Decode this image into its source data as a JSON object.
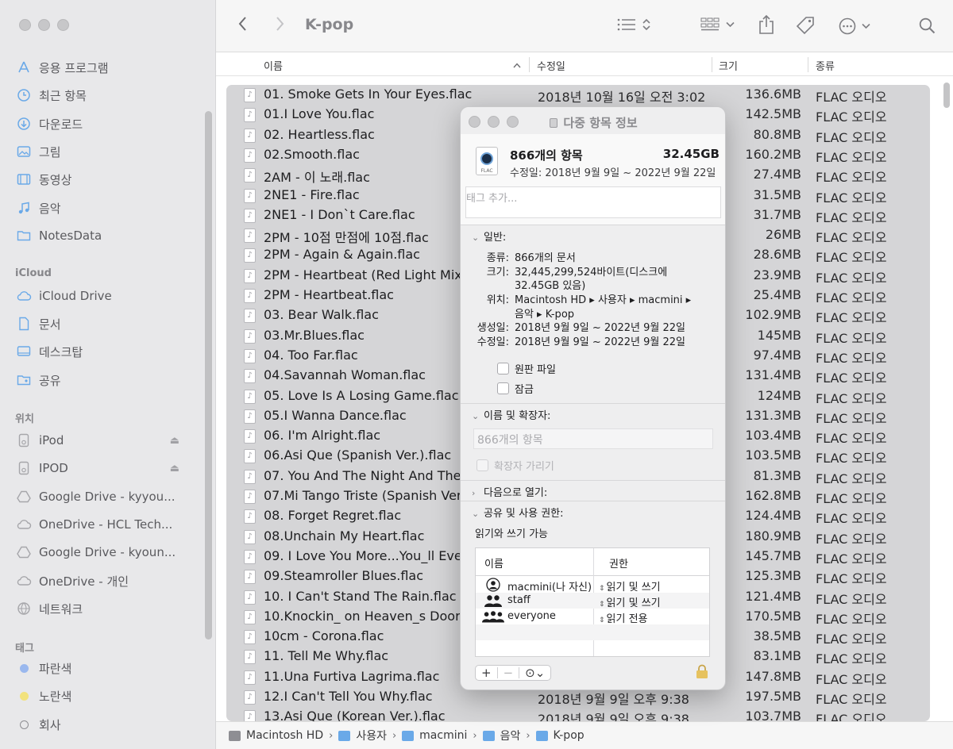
{
  "window": {
    "title": "K-pop"
  },
  "sidebar": {
    "favorites": [
      {
        "label": "응용 프로그램",
        "icon": "applications-icon"
      },
      {
        "label": "최근 항목",
        "icon": "clock-icon"
      },
      {
        "label": "다운로드",
        "icon": "download-icon"
      },
      {
        "label": "그림",
        "icon": "photo-icon"
      },
      {
        "label": "동영상",
        "icon": "film-icon"
      },
      {
        "label": "음악",
        "icon": "music-note-icon"
      },
      {
        "label": "NotesData",
        "icon": "folder-icon"
      }
    ],
    "icloud_header": "iCloud",
    "icloud": [
      {
        "label": "iCloud Drive",
        "icon": "cloud-icon"
      },
      {
        "label": "문서",
        "icon": "document-icon"
      },
      {
        "label": "데스크탑",
        "icon": "desktop-icon"
      },
      {
        "label": "공유",
        "icon": "shared-folder-icon"
      }
    ],
    "locations_header": "위치",
    "locations": [
      {
        "label": "iPod",
        "icon": "ipod-icon",
        "eject": "⏏"
      },
      {
        "label": "IPOD",
        "icon": "ipod-icon",
        "eject": "⏏"
      },
      {
        "label": "Google Drive - kyyou...",
        "icon": "google-drive-icon"
      },
      {
        "label": "OneDrive - HCL Tech...",
        "icon": "cloud-icon"
      },
      {
        "label": "Google Drive - kyoun...",
        "icon": "google-drive-icon"
      },
      {
        "label": "OneDrive - 개인",
        "icon": "cloud-icon"
      },
      {
        "label": "네트워크",
        "icon": "network-icon"
      }
    ],
    "tags_header": "태그",
    "tags": [
      {
        "label": "파란색",
        "color": "#9ab8ee"
      },
      {
        "label": "노란색",
        "color": "#f2e27d"
      },
      {
        "label": "회사",
        "color": ""
      }
    ]
  },
  "columns": {
    "name": "이름",
    "modified": "수정일",
    "size": "크기",
    "kind": "종류"
  },
  "files": [
    {
      "name": "01. Smoke Gets In Your Eyes.flac",
      "modified": "2018년 10월 16일 오전 3:02",
      "size": "136.6MB",
      "kind": "FLAC 오디오"
    },
    {
      "name": "01.I Love You.flac",
      "modified": "",
      "size": "142.5MB",
      "kind": "FLAC 오디오"
    },
    {
      "name": "02. Heartless.flac",
      "modified": "",
      "size": "80.8MB",
      "kind": "FLAC 오디오"
    },
    {
      "name": "02.Smooth.flac",
      "modified": "",
      "size": "160.2MB",
      "kind": "FLAC 오디오"
    },
    {
      "name": "2AM - 이 노래.flac",
      "modified": "",
      "size": "27.4MB",
      "kind": "FLAC 오디오"
    },
    {
      "name": "2NE1 - Fire.flac",
      "modified": "",
      "size": "31.5MB",
      "kind": "FLAC 오디오"
    },
    {
      "name": "2NE1 - I Don`t Care.flac",
      "modified": "",
      "size": "31.7MB",
      "kind": "FLAC 오디오"
    },
    {
      "name": "2PM - 10점 만점에 10점.flac",
      "modified": "",
      "size": "26MB",
      "kind": "FLAC 오디오"
    },
    {
      "name": "2PM - Again & Again.flac",
      "modified": "",
      "size": "28.6MB",
      "kind": "FLAC 오디오"
    },
    {
      "name": "2PM - Heartbeat (Red Light Mix",
      "modified": "",
      "size": "23.9MB",
      "kind": "FLAC 오디오"
    },
    {
      "name": "2PM - Heartbeat.flac",
      "modified": "",
      "size": "25.4MB",
      "kind": "FLAC 오디오"
    },
    {
      "name": "03. Bear Walk.flac",
      "modified": "",
      "size": "102.9MB",
      "kind": "FLAC 오디오"
    },
    {
      "name": "03.Mr.Blues.flac",
      "modified": "",
      "size": "145MB",
      "kind": "FLAC 오디오"
    },
    {
      "name": "04. Too Far.flac",
      "modified": "",
      "size": "97.4MB",
      "kind": "FLAC 오디오"
    },
    {
      "name": "04.Savannah Woman.flac",
      "modified": "",
      "size": "131.4MB",
      "kind": "FLAC 오디오"
    },
    {
      "name": "05. Love Is A Losing Game.flac",
      "modified": "",
      "size": "124MB",
      "kind": "FLAC 오디오"
    },
    {
      "name": "05.I Wanna Dance.flac",
      "modified": "",
      "size": "131.3MB",
      "kind": "FLAC 오디오"
    },
    {
      "name": "06. I'm Alright.flac",
      "modified": "",
      "size": "103.4MB",
      "kind": "FLAC 오디오"
    },
    {
      "name": "06.Asi Que (Spanish Ver.).flac",
      "modified": "",
      "size": "103.5MB",
      "kind": "FLAC 오디오"
    },
    {
      "name": "07. You And The Night And The M",
      "modified": "",
      "size": "81.3MB",
      "kind": "FLAC 오디오"
    },
    {
      "name": "07.Mi Tango Triste (Spanish Ver.)",
      "modified": "",
      "size": "162.8MB",
      "kind": "FLAC 오디오"
    },
    {
      "name": "08. Forget Regret.flac",
      "modified": "",
      "size": "124.4MB",
      "kind": "FLAC 오디오"
    },
    {
      "name": "08.Unchain My Heart.flac",
      "modified": "",
      "size": "180.9MB",
      "kind": "FLAC 오디오"
    },
    {
      "name": "09. I Love You More...You_ll Ever",
      "modified": "",
      "size": "145.7MB",
      "kind": "FLAC 오디오"
    },
    {
      "name": "09.Steamroller Blues.flac",
      "modified": "",
      "size": "125.3MB",
      "kind": "FLAC 오디오"
    },
    {
      "name": "10. I Can't Stand The Rain.flac",
      "modified": "",
      "size": "121.4MB",
      "kind": "FLAC 오디오"
    },
    {
      "name": "10.Knockin_ on Heaven_s Door.f",
      "modified": "",
      "size": "170.5MB",
      "kind": "FLAC 오디오"
    },
    {
      "name": "10cm - Corona.flac",
      "modified": "",
      "size": "38.5MB",
      "kind": "FLAC 오디오"
    },
    {
      "name": "11. Tell Me Why.flac",
      "modified": "",
      "size": "83.1MB",
      "kind": "FLAC 오디오"
    },
    {
      "name": "11.Una Furtiva Lagrima.flac",
      "modified": "",
      "size": "147.8MB",
      "kind": "FLAC 오디오"
    },
    {
      "name": "12.I Can't Tell You Why.flac",
      "modified": "2018년 9월 9일 오후 9:38",
      "size": "197.5MB",
      "kind": "FLAC 오디오"
    },
    {
      "name": "13.Asi Que (Korean Ver.).flac",
      "modified": "2018년 9월 9일 오후 9:38",
      "size": "103.7MB",
      "kind": "FLAC 오디오"
    }
  ],
  "pathbar": [
    {
      "label": "Macintosh HD",
      "color": "#8e8e93"
    },
    {
      "label": "사용자",
      "color": "#6aa9e8"
    },
    {
      "label": "macmini",
      "color": "#6aa9e8"
    },
    {
      "label": "음악",
      "color": "#6aa9e8"
    },
    {
      "label": "K-pop",
      "color": "#6aa9e8"
    }
  ],
  "info": {
    "title": "다중 항목 정보",
    "count": "866개의 항목",
    "size": "32.45GB",
    "modified": "수정일: 2018년 9월 9일 ~ 2022년 9월 22일",
    "tags_placeholder": "태그 추가...",
    "general_label": "일반:",
    "general": {
      "kind_key": "종류:",
      "kind_val": "866개의 문서",
      "size_key": "크기:",
      "size_val1": "32,445,299,524바이트(디스크에",
      "size_val2": "32.45GB 있음)",
      "where_key": "위치:",
      "where_val1": "Macintosh HD ▸ 사용자 ▸ macmini ▸",
      "where_val2": "음악 ▸ K-pop",
      "created_key": "생성일:",
      "created_val": "2018년 9월 9일 ~ 2022년 9월 22일",
      "modified_key": "수정일:",
      "modified_val": "2018년 9월 9일 ~ 2022년 9월 22일"
    },
    "stationery_label": "원판 파일",
    "locked_label": "잠금",
    "name_ext_label": "이름 및 확장자:",
    "name_field": "866개의 항목",
    "hide_ext_label": "확장자 가리기",
    "open_with_label": "다음으로 열기:",
    "sharing_label": "공유 및 사용 권한:",
    "sharing_status": "읽기와 쓰기 가능",
    "perm_headers": {
      "name": "이름",
      "privilege": "권한"
    },
    "permissions": [
      {
        "name": "macmini(나 자신)",
        "privilege": "읽기 및 쓰기",
        "icon": "user-icon"
      },
      {
        "name": "staff",
        "privilege": "읽기 및 쓰기",
        "icon": "group-icon"
      },
      {
        "name": "everyone",
        "privilege": "읽기 전용",
        "icon": "everyone-icon"
      }
    ],
    "footer": {
      "add": "+",
      "remove": "−",
      "action": "⊙⌄"
    }
  }
}
